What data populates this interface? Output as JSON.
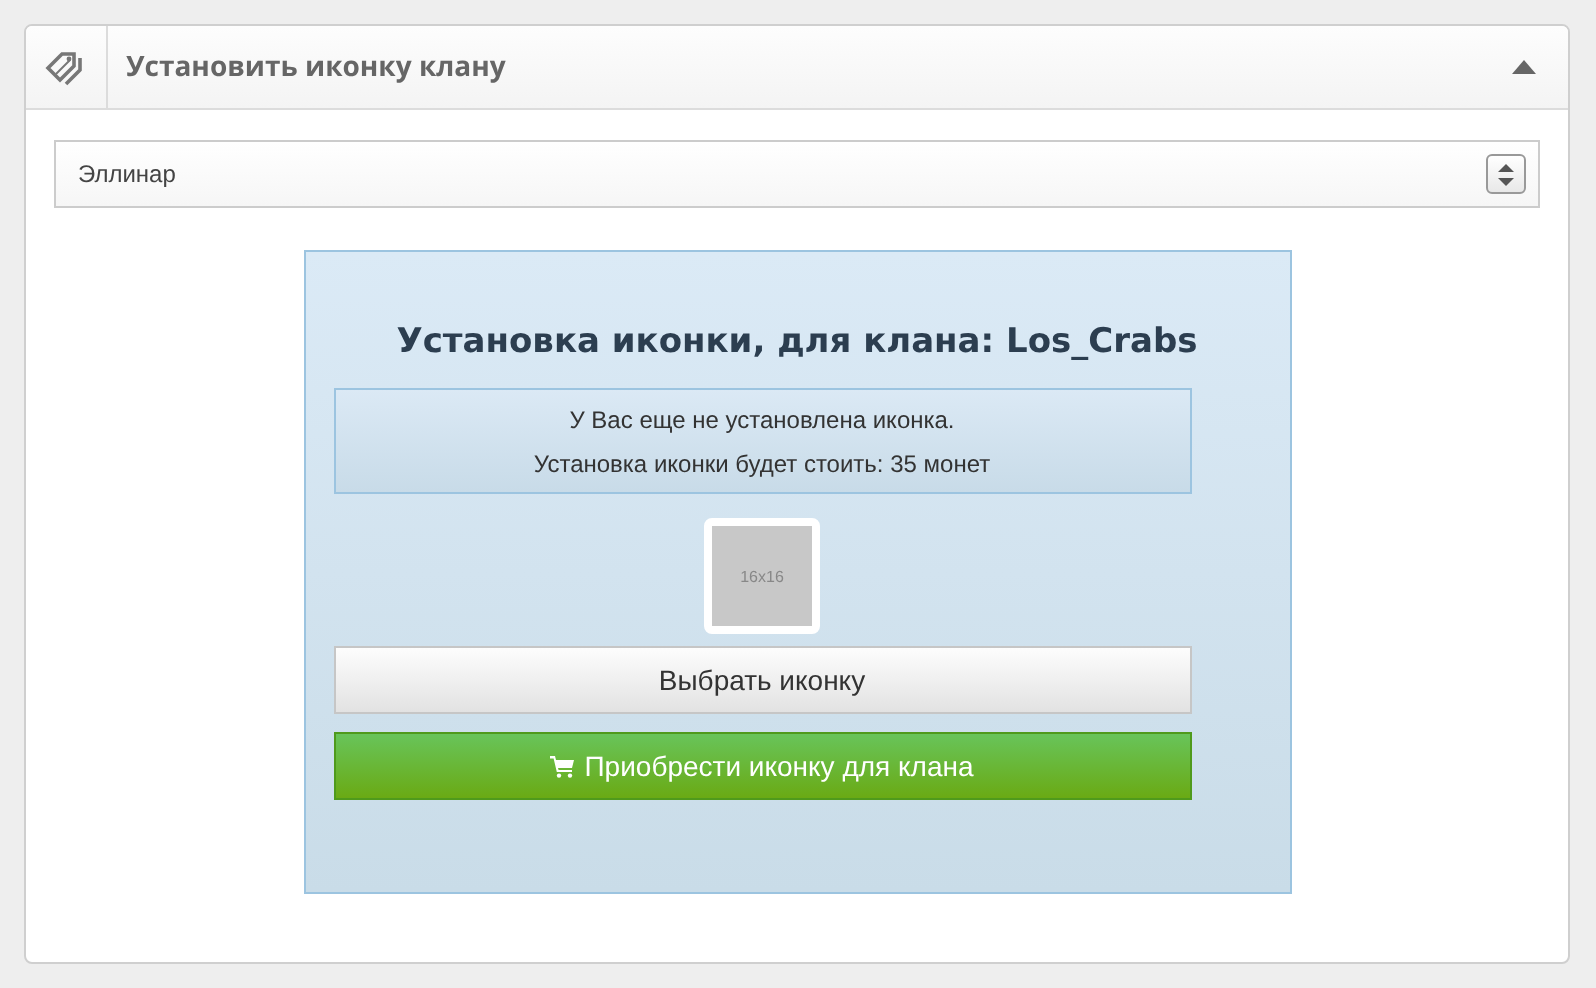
{
  "panel": {
    "title": "Установить иконку клану",
    "collapsed": false
  },
  "server_select": {
    "value": "Эллинар"
  },
  "icon_setup": {
    "heading": "Установка иконки, для клана: Los_Crabs",
    "notice": [
      "У Вас еще не установлена иконка.",
      "Установка иконки будет стоить: 35 монет"
    ],
    "preview": {
      "label": "16x16"
    },
    "buttons": [
      {
        "label": "Выбрать иконку",
        "kind": "default"
      },
      {
        "label": "Приобрести иконку для клана",
        "kind": "buy"
      }
    ]
  }
}
